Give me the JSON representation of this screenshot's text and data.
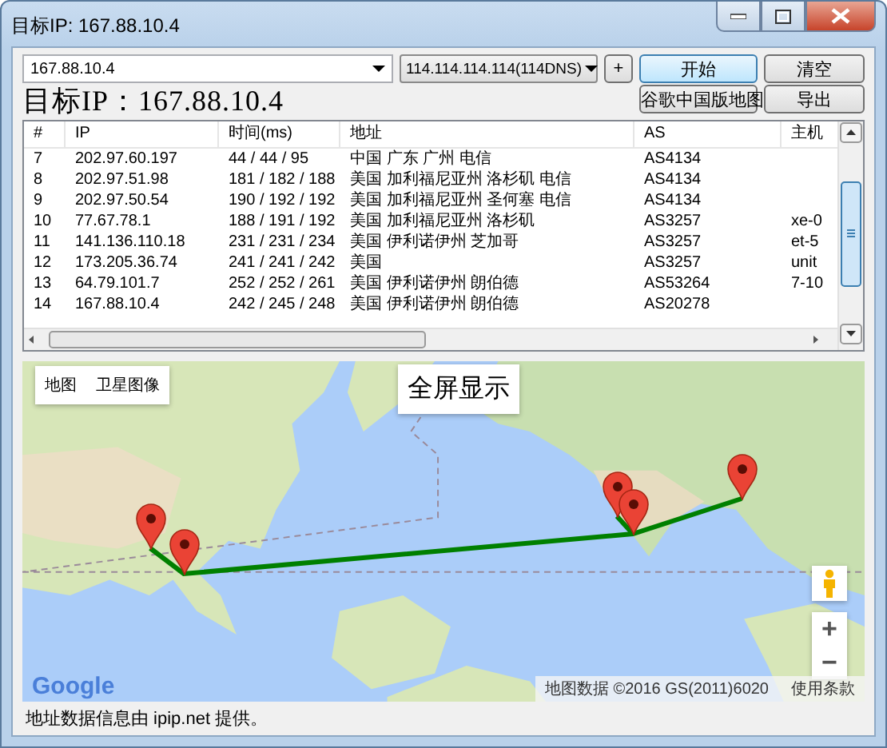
{
  "window": {
    "title": "目标IP: 167.88.10.4"
  },
  "toolbar": {
    "target": {
      "value": "167.88.10.4"
    },
    "dns": {
      "value": "114.114.114.114(114DNS)"
    },
    "buttons": [
      {
        "label": "+",
        "default": false
      },
      {
        "label": "开始",
        "default": true
      },
      {
        "label": "清空",
        "default": false
      },
      {
        "label": "谷歌中国版地图",
        "default": false
      },
      {
        "label": "导出",
        "default": false
      }
    ],
    "target_label": "目标IP：167.88.10.4"
  },
  "table": {
    "columns": [
      "#",
      "IP",
      "时间(ms)",
      "地址",
      "AS",
      "主机"
    ],
    "rows": [
      [
        "7",
        "202.97.60.197",
        "44 / 44 / 95",
        "中国 广东 广州 电信",
        "AS4134",
        ""
      ],
      [
        "8",
        "202.97.51.98",
        "181 / 182 / 188",
        "美国 加利福尼亚州 洛杉矶 电信",
        "AS4134",
        ""
      ],
      [
        "9",
        "202.97.50.54",
        "190 / 192 / 192",
        "美国 加利福尼亚州 圣何塞 电信",
        "AS4134",
        ""
      ],
      [
        "10",
        "77.67.78.1",
        "188 / 191 / 192",
        "美国 加利福尼亚州 洛杉矶",
        "AS3257",
        "xe-0"
      ],
      [
        "11",
        "141.136.110.18",
        "231 / 231 / 234",
        "美国 伊利诺伊州 芝加哥",
        "AS3257",
        "et-5"
      ],
      [
        "12",
        "173.205.36.74",
        "241 / 241 / 242",
        "美国",
        "AS3257",
        "unit"
      ],
      [
        "13",
        "64.79.101.7",
        "252 / 252 / 261",
        "美国 伊利诺伊州 朗伯德",
        "AS53264",
        "7-10"
      ],
      [
        "14",
        "167.88.10.4",
        "242 / 245 / 248",
        "美国 伊利诺伊州 朗伯德",
        "AS20278",
        ""
      ]
    ]
  },
  "map": {
    "map_types": [
      "地图",
      "卫星图像"
    ],
    "fullscreen": "全屏显示",
    "zoom_in": "+",
    "zoom_out": "−",
    "logo": "Google",
    "attribution": "地图数据 ©2016 GS(2011)6020",
    "terms": "使用条款"
  },
  "footer": "地址数据信息由 ipip.net 提供。"
}
